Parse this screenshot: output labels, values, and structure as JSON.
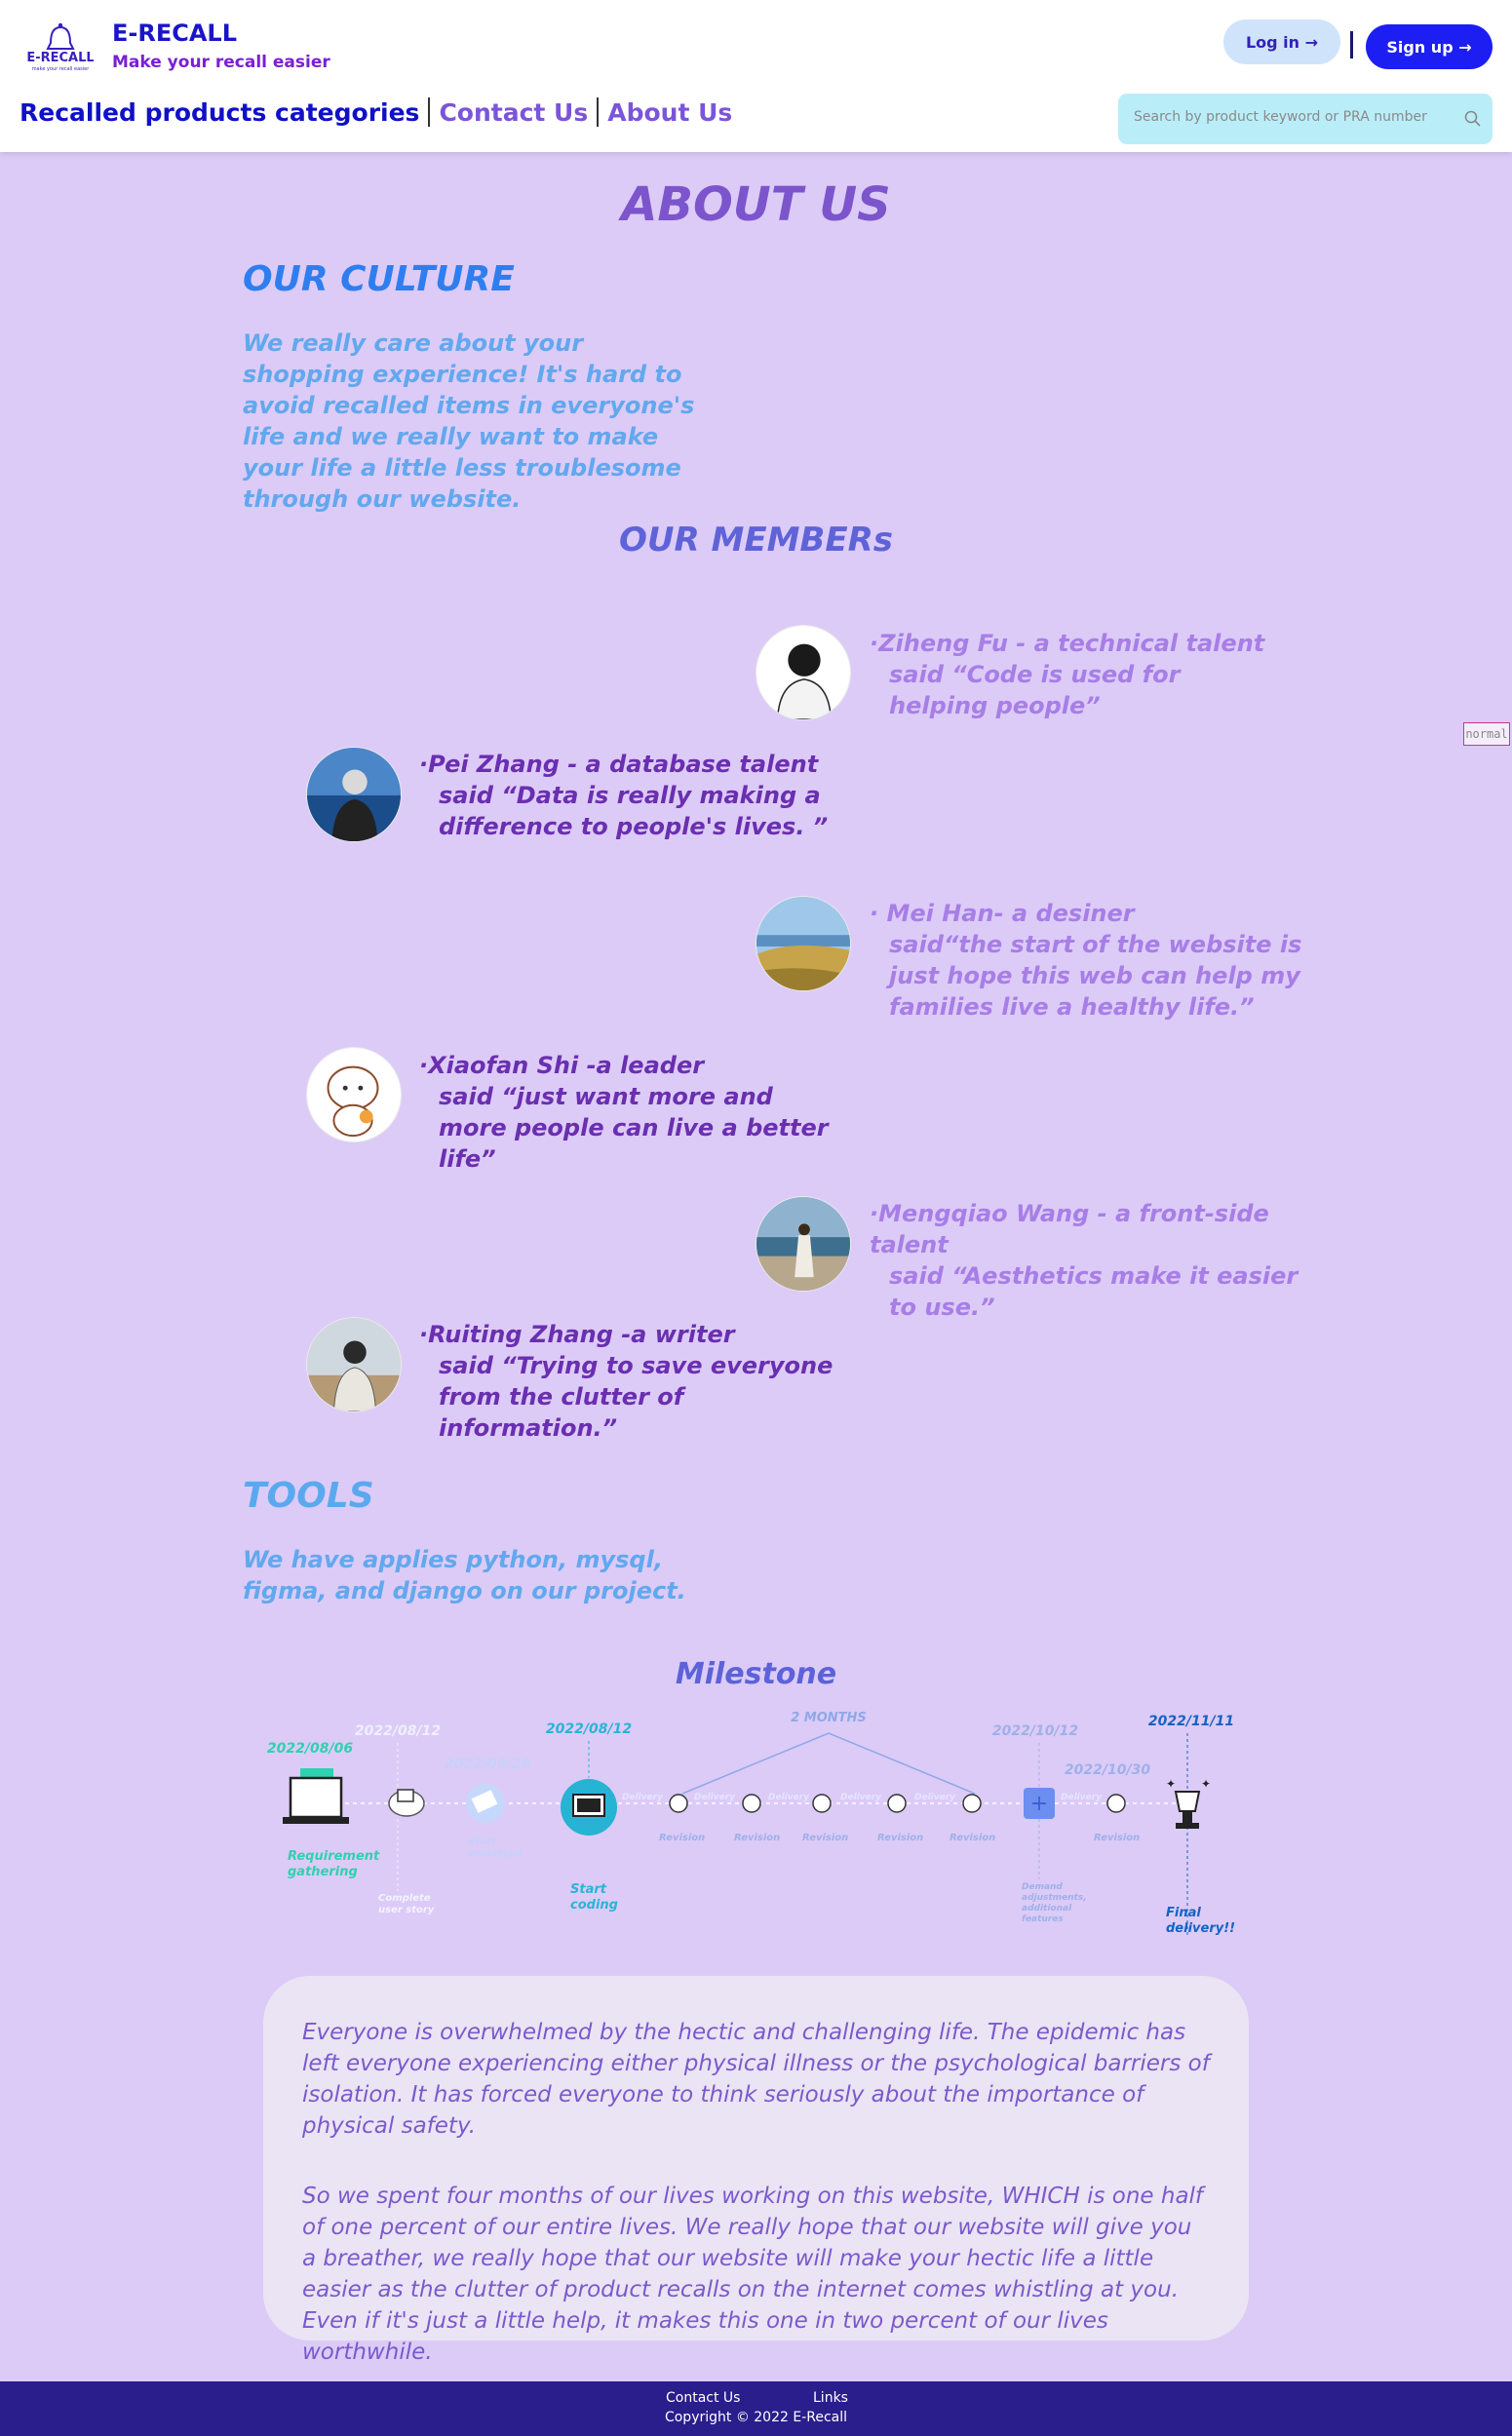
{
  "brand": {
    "name": "E-RECALL",
    "tagline": "Make your recall easier",
    "logo_text": "E-RECALL",
    "logo_subtext": "make your recall easier"
  },
  "auth": {
    "login_label": "Log in →",
    "signup_label": "Sign up →"
  },
  "nav": {
    "items": [
      {
        "label": "Recalled products categories"
      },
      {
        "label": "Contact Us"
      },
      {
        "label": "About Us"
      }
    ]
  },
  "search": {
    "placeholder": "Search by product keyword or PRA number",
    "icon": "search-icon"
  },
  "side_tag": "normal",
  "page": {
    "title": "ABOUT US",
    "culture": {
      "title": "OUR CULTURE",
      "text": "We really care about your shopping experience! It's hard to avoid recalled items in everyone's life and we really want to make your life a little less troublesome through our website."
    },
    "members_title": "OUR MEMBERs",
    "members": [
      {
        "name_line": "·Ziheng Fu - a technical talent",
        "quote": "said “Code is used for helping people”"
      },
      {
        "name_line": "·Pei Zhang - a database talent",
        "quote": "said “Data is really making a difference to people's lives. ”"
      },
      {
        "name_line": "· Mei Han- a desiner",
        "quote": "said“the start of the website is just hope this web can help my families live a healthy life.”"
      },
      {
        "name_line": "·Xiaofan Shi -a leader",
        "quote": "said “just want more and more people can live a better life”"
      },
      {
        "name_line": "·Mengqiao Wang - a front-side talent",
        "quote": "said “Aesthetics make it easier to use.”"
      },
      {
        "name_line": "·Ruiting Zhang -a writer",
        "quote": "said “Trying to save everyone from the clutter of information.”"
      }
    ],
    "tools": {
      "title": "TOOLS",
      "text": "We have applies python, mysql, figma, and django on our project."
    },
    "milestone": {
      "title": "Milestone",
      "dates": [
        "2022/08/06",
        "2022/08/12",
        "2022/08/28",
        "2022/08/12",
        "2 MONTHS",
        "2022/10/12",
        "2022/10/30",
        "2022/11/11"
      ],
      "labels": {
        "requirement": "Requirement gathering",
        "user_story": "Complete user story",
        "prototype": "Start prototype",
        "coding": "Start coding",
        "delivery": "Delivery",
        "revision": "Revision",
        "demand": "Demand adjustments, additional features",
        "final": "Final delivery!!"
      }
    },
    "story": {
      "p1": "Everyone is overwhelmed by the hectic and challenging life. The epidemic has left everyone experiencing either physical illness or the psychological barriers of isolation. It has forced everyone to think seriously about the importance of physical safety.",
      "p2": "So we spent four months of our lives working on this website, WHICH is one half of one percent of our entire lives. We really hope that our website will give you a breather, we really hope that our website will make your hectic life a little easier as the clutter of product recalls on the internet comes whistling at you. Even if it's just a little help, it makes this one in two percent of our lives worthwhile."
    }
  },
  "footer": {
    "contact": "Contact Us",
    "links": "Links",
    "copyright": "Copyright © 2022 E-Recall"
  }
}
